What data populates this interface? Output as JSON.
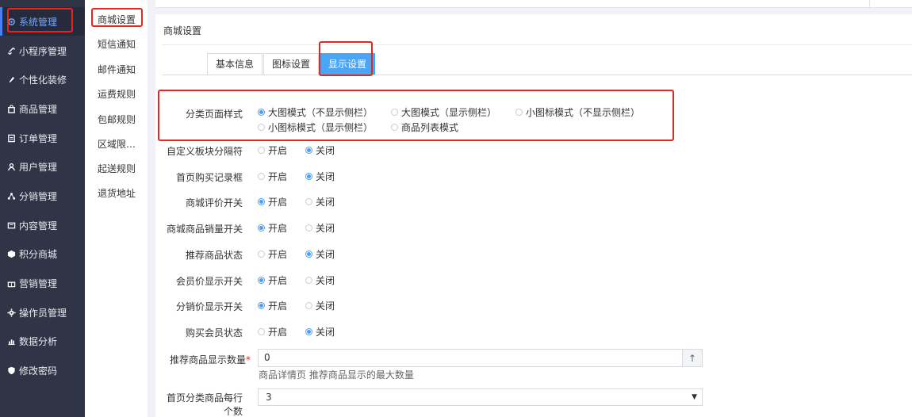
{
  "sidebar": {
    "items": [
      {
        "label": "系统管理",
        "icon": "settings-icon",
        "active": true
      },
      {
        "label": "小程序管理",
        "icon": "link-icon"
      },
      {
        "label": "个性化装修",
        "icon": "brush-icon"
      },
      {
        "label": "商品管理",
        "icon": "bag-icon"
      },
      {
        "label": "订单管理",
        "icon": "list-icon"
      },
      {
        "label": "用户管理",
        "icon": "user-icon"
      },
      {
        "label": "分销管理",
        "icon": "share-icon"
      },
      {
        "label": "内容管理",
        "icon": "content-icon"
      },
      {
        "label": "积分商城",
        "icon": "box-icon"
      },
      {
        "label": "营销管理",
        "icon": "gift-icon"
      },
      {
        "label": "操作员管理",
        "icon": "gear-icon"
      },
      {
        "label": "数据分析",
        "icon": "chart-icon"
      },
      {
        "label": "修改密码",
        "icon": "shield-icon"
      }
    ]
  },
  "subnav": {
    "items": [
      "商城设置",
      "短信通知",
      "邮件通知",
      "运费规则",
      "包邮规则",
      "区域限…",
      "起送规则",
      "退货地址"
    ]
  },
  "panel": {
    "title": "商城设置",
    "tabs": [
      "基本信息",
      "图标设置",
      "显示设置"
    ],
    "active_tab": "显示设置"
  },
  "form": {
    "category_style": {
      "label": "分类页面样式",
      "options": [
        "大图模式（不显示侧栏）",
        "大图模式（显示侧栏）",
        "小图标模式（不显示侧栏）",
        "小图标模式（显示侧栏）",
        "商品列表模式"
      ],
      "selected": "大图模式（不显示侧栏）"
    },
    "toggles": [
      {
        "label": "自定义板块分隔符",
        "value": "关闭"
      },
      {
        "label": "首页购买记录框",
        "value": "关闭"
      },
      {
        "label": "商城评价开关",
        "value": "开启"
      },
      {
        "label": "商城商品销量开关",
        "value": "开启"
      },
      {
        "label": "推荐商品状态",
        "value": "关闭"
      },
      {
        "label": "会员价显示开关",
        "value": "开启"
      },
      {
        "label": "分销价显示开关",
        "value": "开启"
      },
      {
        "label": "购买会员状态",
        "value": "关闭"
      }
    ],
    "on_label": "开启",
    "off_label": "关闭",
    "recommend_count": {
      "label": "推荐商品显示数量",
      "required_mark": "*",
      "value": "0",
      "stepper_symbol": "↑",
      "hint": "商品详情页 推荐商品显示的最大数量"
    },
    "per_row": {
      "label_line1": "首页分类商品每行",
      "label_line2": "个数",
      "value": "3",
      "arrow": "▼"
    }
  },
  "colors": {
    "sidebar_bg": "#2f3447",
    "accent": "#4aa6f5",
    "highlight_box": "#e5261f"
  }
}
